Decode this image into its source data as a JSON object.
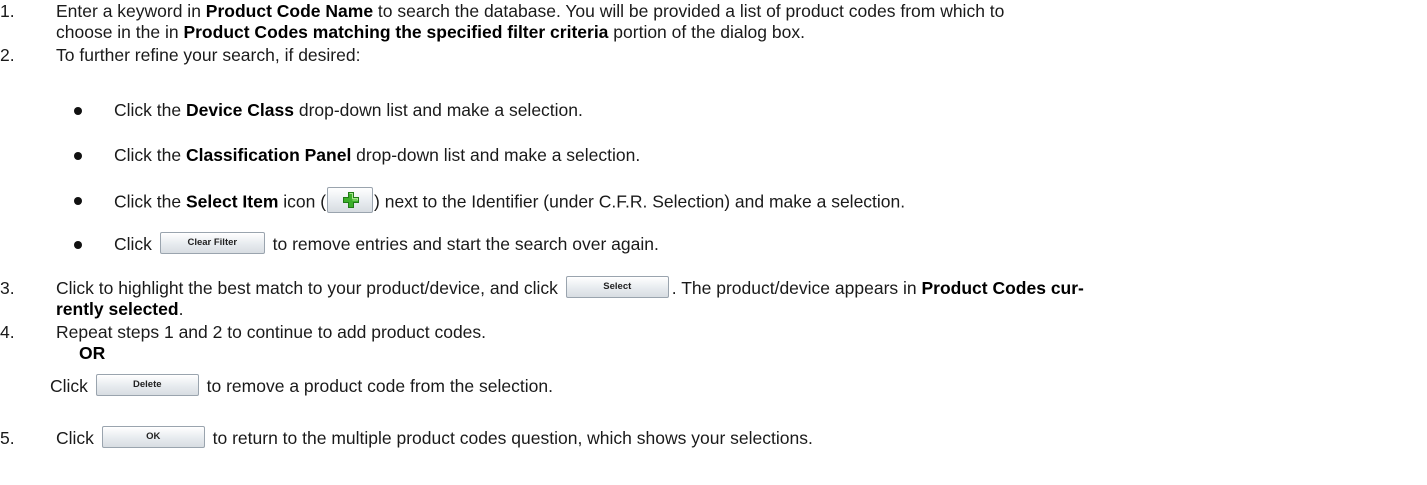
{
  "colors": {
    "text": "#1a1a1a",
    "bold": "#000000",
    "plus_icon": "#3cae2a"
  },
  "step1": {
    "num": "1.",
    "a": "Enter a keyword in ",
    "b1": "Product Code Name",
    "c": " to search the database.  You will be provided a list of product codes from which to",
    "d": "choose in the in ",
    "b2": "Product Codes matching the specified filter criteria",
    "e": " portion of the dialog box."
  },
  "step2": {
    "num": "2.",
    "text": "To further refine your search, if desired:"
  },
  "bullets": {
    "b1": {
      "a": "Click the ",
      "bold": "Device Class",
      "c": " drop-down list and make a selection."
    },
    "b2": {
      "a": "Click the ",
      "bold": "Classification Panel",
      "c": " drop-down list and make a selection."
    },
    "b3": {
      "a": "Click the ",
      "bold": "Select Item",
      "c": " icon (",
      "d": ") next to the Identifier (under C.F.R. Selection) and make a selection.",
      "icon": "plus-icon"
    },
    "b4": {
      "a": "Click ",
      "button": "Clear Filter",
      "c": " to remove entries and start the search over again."
    }
  },
  "step3": {
    "num": "3.",
    "a": "Click to highlight the best match to your product/device, and click ",
    "button": "Select",
    "c": ". The product/device appears in ",
    "bold1": "Product Codes cur-",
    "bold2": "rently selected",
    "d": "."
  },
  "step4": {
    "num": "4.",
    "text": "Repeat steps 1 and 2 to continue to add product codes.",
    "or": "OR",
    "a": "Click ",
    "button": "Delete",
    "c": " to remove a product code from the selection."
  },
  "step5": {
    "num": "5.",
    "a": "Click ",
    "button": "OK",
    "c": " to return to the multiple product codes question, which shows your selections."
  }
}
